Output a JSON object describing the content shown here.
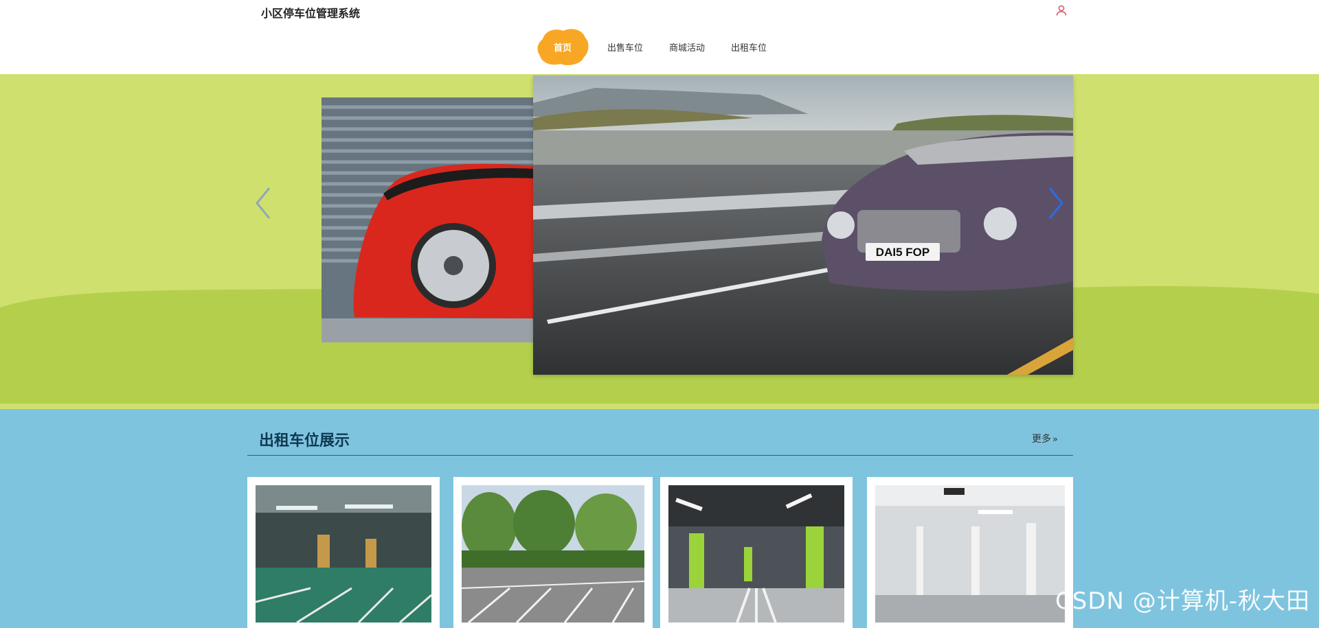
{
  "header": {
    "site_title": "小区停车位管理系统",
    "user_icon": "user-icon"
  },
  "nav": {
    "items": [
      {
        "label": "首页",
        "active": true
      },
      {
        "label": "出售车位",
        "active": false
      },
      {
        "label": "商城活动",
        "active": false
      },
      {
        "label": "出租车位",
        "active": false
      }
    ],
    "active_color": "#f5a623"
  },
  "carousel": {
    "prev_icon": "chevron-left-icon",
    "next_icon": "chevron-right-icon",
    "plate_text": "DAI5 FOP",
    "background": "#cfe06e",
    "band_color": "#b4cf4c"
  },
  "section": {
    "title": "出租车位展示",
    "more_label": "更多",
    "more_icon": "double-chevron-right-icon"
  },
  "cards": [
    {
      "image": "underground-parking-green-floor"
    },
    {
      "image": "outdoor-parking-lot-trees"
    },
    {
      "image": "underground-parking-green-pillars"
    },
    {
      "image": "underground-parking-white-pillars"
    }
  ],
  "watermark": "CSDN @计算机-秋大田"
}
